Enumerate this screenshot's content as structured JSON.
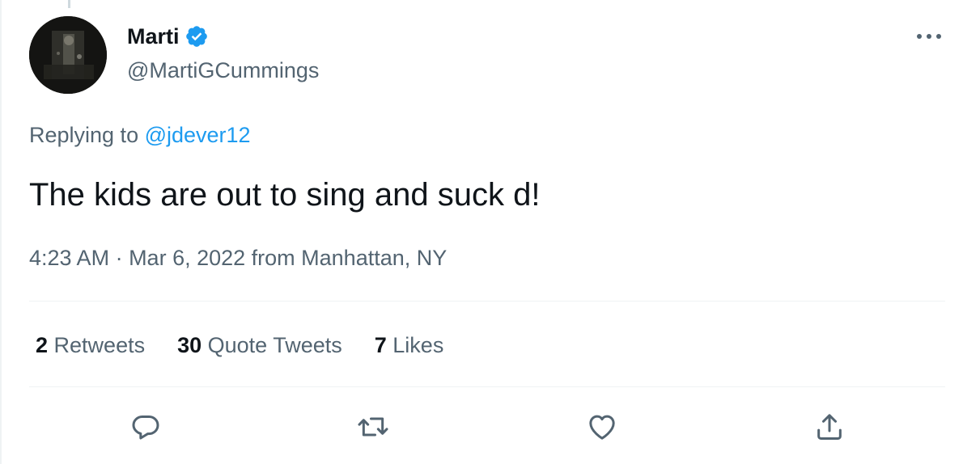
{
  "author": {
    "name": "Marti",
    "handle": "@MartiGCummings",
    "verified_icon": "verified-badge-icon",
    "verified_color": "#1d9bf0"
  },
  "reply": {
    "prefix": "Replying to ",
    "to_handle": "@jdever12"
  },
  "tweet": {
    "text": "The kids are out to sing and suck d!"
  },
  "meta": {
    "time": "4:23 AM",
    "separator": " · ",
    "date": "Mar 6, 2022",
    "location": " from Manhattan, NY"
  },
  "stats": {
    "retweets_count": "2",
    "retweets_label": " Retweets",
    "quotes_count": "30",
    "quotes_label": " Quote Tweets",
    "likes_count": "7",
    "likes_label": " Likes"
  },
  "actions": {
    "reply_icon": "reply-icon",
    "retweet_icon": "retweet-icon",
    "like_icon": "heart-icon",
    "share_icon": "share-icon",
    "more_icon": "more-horizontal-icon"
  },
  "colors": {
    "text_primary": "#0f1419",
    "text_secondary": "#536471",
    "link": "#1d9bf0",
    "divider": "#eff3f4"
  }
}
